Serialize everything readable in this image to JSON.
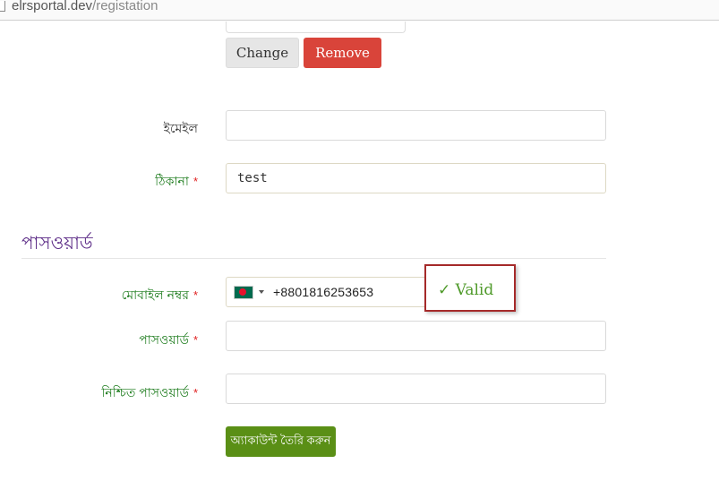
{
  "browser": {
    "url_host": "elrsportal.dev",
    "url_path": "/registation"
  },
  "photo": {
    "change_label": "Change",
    "remove_label": "Remove"
  },
  "form": {
    "email_label": "ইমেইল",
    "address_label": "ঠিকানা",
    "address_value": "test",
    "section_title": "পাসওয়ার্ড",
    "mobile_label": "মোবাইল নম্বর",
    "mobile_value": "+8801816253653",
    "mobile_flag": "bangladesh-flag",
    "validation_text": "✓ Valid",
    "password_label": "পাসওয়ার্ড",
    "confirm_password_label": "নিশ্চিত পাসওয়ার্ড",
    "required_mark": "*",
    "submit_label": "অ্যাকাউন্ট তৈরি করুন"
  },
  "colors": {
    "required_label": "#1a7a1a",
    "required_star": "#e02020",
    "section_title": "#5b2a86",
    "remove_button": "#d9443a",
    "submit_button": "#5a8f16",
    "valid_text": "#4f9a2a",
    "highlight_border": "#a52a2a"
  }
}
